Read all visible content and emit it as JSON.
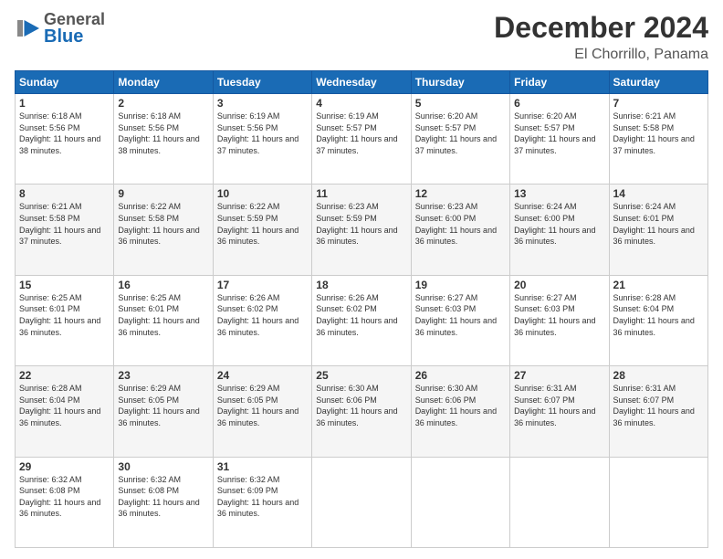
{
  "header": {
    "logo_general": "General",
    "logo_blue": "Blue",
    "title": "December 2024",
    "subtitle": "El Chorrillo, Panama"
  },
  "days": [
    "Sunday",
    "Monday",
    "Tuesday",
    "Wednesday",
    "Thursday",
    "Friday",
    "Saturday"
  ],
  "weeks": [
    [
      {
        "num": "1",
        "sunrise": "6:18 AM",
        "sunset": "5:56 PM",
        "daylight": "11 hours and 38 minutes."
      },
      {
        "num": "2",
        "sunrise": "6:18 AM",
        "sunset": "5:56 PM",
        "daylight": "11 hours and 38 minutes."
      },
      {
        "num": "3",
        "sunrise": "6:19 AM",
        "sunset": "5:56 PM",
        "daylight": "11 hours and 37 minutes."
      },
      {
        "num": "4",
        "sunrise": "6:19 AM",
        "sunset": "5:57 PM",
        "daylight": "11 hours and 37 minutes."
      },
      {
        "num": "5",
        "sunrise": "6:20 AM",
        "sunset": "5:57 PM",
        "daylight": "11 hours and 37 minutes."
      },
      {
        "num": "6",
        "sunrise": "6:20 AM",
        "sunset": "5:57 PM",
        "daylight": "11 hours and 37 minutes."
      },
      {
        "num": "7",
        "sunrise": "6:21 AM",
        "sunset": "5:58 PM",
        "daylight": "11 hours and 37 minutes."
      }
    ],
    [
      {
        "num": "8",
        "sunrise": "6:21 AM",
        "sunset": "5:58 PM",
        "daylight": "11 hours and 37 minutes."
      },
      {
        "num": "9",
        "sunrise": "6:22 AM",
        "sunset": "5:58 PM",
        "daylight": "11 hours and 36 minutes."
      },
      {
        "num": "10",
        "sunrise": "6:22 AM",
        "sunset": "5:59 PM",
        "daylight": "11 hours and 36 minutes."
      },
      {
        "num": "11",
        "sunrise": "6:23 AM",
        "sunset": "5:59 PM",
        "daylight": "11 hours and 36 minutes."
      },
      {
        "num": "12",
        "sunrise": "6:23 AM",
        "sunset": "6:00 PM",
        "daylight": "11 hours and 36 minutes."
      },
      {
        "num": "13",
        "sunrise": "6:24 AM",
        "sunset": "6:00 PM",
        "daylight": "11 hours and 36 minutes."
      },
      {
        "num": "14",
        "sunrise": "6:24 AM",
        "sunset": "6:01 PM",
        "daylight": "11 hours and 36 minutes."
      }
    ],
    [
      {
        "num": "15",
        "sunrise": "6:25 AM",
        "sunset": "6:01 PM",
        "daylight": "11 hours and 36 minutes."
      },
      {
        "num": "16",
        "sunrise": "6:25 AM",
        "sunset": "6:01 PM",
        "daylight": "11 hours and 36 minutes."
      },
      {
        "num": "17",
        "sunrise": "6:26 AM",
        "sunset": "6:02 PM",
        "daylight": "11 hours and 36 minutes."
      },
      {
        "num": "18",
        "sunrise": "6:26 AM",
        "sunset": "6:02 PM",
        "daylight": "11 hours and 36 minutes."
      },
      {
        "num": "19",
        "sunrise": "6:27 AM",
        "sunset": "6:03 PM",
        "daylight": "11 hours and 36 minutes."
      },
      {
        "num": "20",
        "sunrise": "6:27 AM",
        "sunset": "6:03 PM",
        "daylight": "11 hours and 36 minutes."
      },
      {
        "num": "21",
        "sunrise": "6:28 AM",
        "sunset": "6:04 PM",
        "daylight": "11 hours and 36 minutes."
      }
    ],
    [
      {
        "num": "22",
        "sunrise": "6:28 AM",
        "sunset": "6:04 PM",
        "daylight": "11 hours and 36 minutes."
      },
      {
        "num": "23",
        "sunrise": "6:29 AM",
        "sunset": "6:05 PM",
        "daylight": "11 hours and 36 minutes."
      },
      {
        "num": "24",
        "sunrise": "6:29 AM",
        "sunset": "6:05 PM",
        "daylight": "11 hours and 36 minutes."
      },
      {
        "num": "25",
        "sunrise": "6:30 AM",
        "sunset": "6:06 PM",
        "daylight": "11 hours and 36 minutes."
      },
      {
        "num": "26",
        "sunrise": "6:30 AM",
        "sunset": "6:06 PM",
        "daylight": "11 hours and 36 minutes."
      },
      {
        "num": "27",
        "sunrise": "6:31 AM",
        "sunset": "6:07 PM",
        "daylight": "11 hours and 36 minutes."
      },
      {
        "num": "28",
        "sunrise": "6:31 AM",
        "sunset": "6:07 PM",
        "daylight": "11 hours and 36 minutes."
      }
    ],
    [
      {
        "num": "29",
        "sunrise": "6:32 AM",
        "sunset": "6:08 PM",
        "daylight": "11 hours and 36 minutes."
      },
      {
        "num": "30",
        "sunrise": "6:32 AM",
        "sunset": "6:08 PM",
        "daylight": "11 hours and 36 minutes."
      },
      {
        "num": "31",
        "sunrise": "6:32 AM",
        "sunset": "6:09 PM",
        "daylight": "11 hours and 36 minutes."
      },
      null,
      null,
      null,
      null
    ]
  ]
}
